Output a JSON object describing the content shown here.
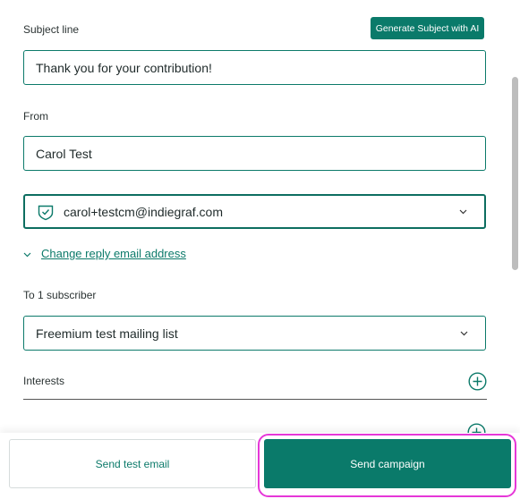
{
  "subject": {
    "label": "Subject line",
    "generate_button": "Generate Subject with AI",
    "value": "Thank you for your contribution!"
  },
  "from": {
    "label": "From",
    "name_value": "Carol Test",
    "email_value": "carol+testcm@indiegraf.com",
    "icons": {
      "verified": "shield-check-icon",
      "dropdown": "chevron-down-icon"
    }
  },
  "reply": {
    "link_label": "Change reply email address",
    "icon": "chevron-down-icon"
  },
  "recipients": {
    "label": "To 1 subscriber",
    "list_value": "Freemium test mailing list"
  },
  "interests": {
    "label": "Interests",
    "icon": "plus-circle-icon"
  },
  "segments": {
    "icon": "plus-circle-icon"
  },
  "footer": {
    "test_button": "Send test email",
    "send_button": "Send campaign"
  },
  "colors": {
    "accent": "#0a7a6a",
    "highlight": "#e637d8"
  }
}
